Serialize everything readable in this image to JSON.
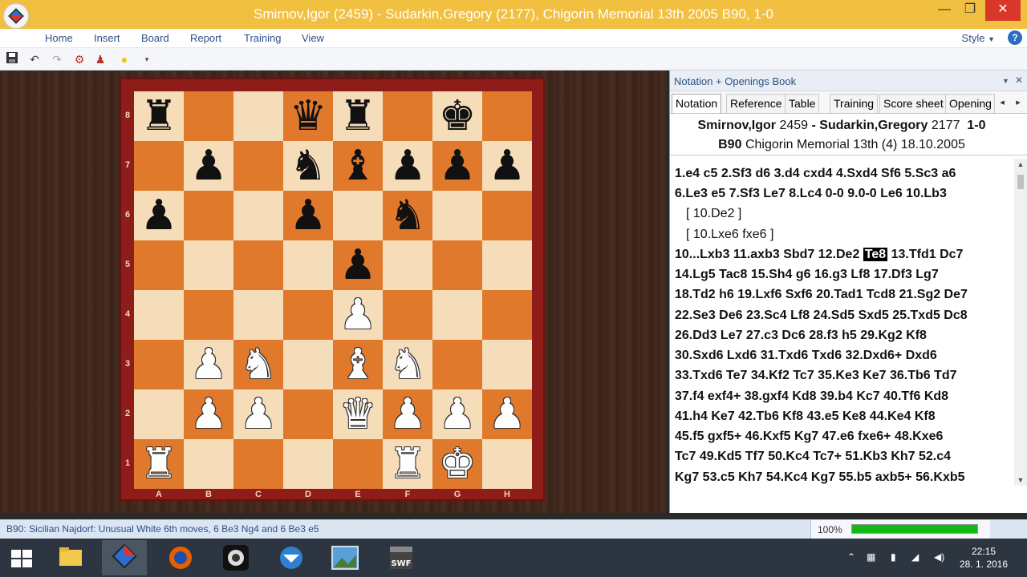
{
  "window": {
    "title": "Smirnov,Igor (2459) - Sudarkin,Gregory (2177), Chigorin Memorial 13th 2005  B90, 1-0",
    "minimize": "—",
    "maximize": "❐",
    "close": "✕"
  },
  "menu": [
    "Home",
    "Insert",
    "Board",
    "Report",
    "Training",
    "View"
  ],
  "style_label": "Style",
  "style_arrow": "▼",
  "help_label": "?",
  "toolbar_icons": [
    "save-icon",
    "undo-icon",
    "redo-icon",
    "engine-icon",
    "figure-icon",
    "bulb-icon",
    "dropdown-icon"
  ],
  "board": {
    "files": [
      "A",
      "B",
      "C",
      "D",
      "E",
      "F",
      "G",
      "H"
    ],
    "ranks": [
      "8",
      "7",
      "6",
      "5",
      "4",
      "3",
      "2",
      "1"
    ]
  },
  "panel": {
    "title": "Notation + Openings Book",
    "pin": "▼",
    "close": "✕",
    "tabs": [
      "Notation",
      "Reference",
      "Table",
      "Training",
      "Score sheet",
      "Opening"
    ],
    "tab_prev": "◂",
    "tab_next": "▸",
    "white_name": "Smirnov,Igor",
    "white_elo": "2459",
    "dash": "-",
    "black_name": "Sudarkin,Gregory",
    "black_elo": "2177",
    "result": "1-0",
    "eco": "B90",
    "event": "Chigorin Memorial 13th (4) 18.10.2005"
  },
  "moves": [
    "1.e4  c5  2.Sf3  d6  3.d4  cxd4  4.Sxd4  Sf6  5.Sc3  a6",
    "6.Le3  e5  7.Sf3  Le7  8.Lc4  0-0  9.0-0  Le6  10.Lb3",
    "[ 10.De2 ]",
    "[ 10.Lxe6  fxe6 ]",
    "14.Lg5  Tac8  15.Sh4  g6  16.g3  Lf8  17.Df3  Lg7",
    "18.Td2  h6  19.Lxf6  Sxf6  20.Tad1  Tcd8  21.Sg2  De7",
    "22.Se3  De6  23.Sc4  Lf8  24.Sd5  Sxd5  25.Txd5  Dc8",
    "26.Dd3  Le7  27.c3  Dc6  28.f3  h5  29.Kg2  Kf8",
    "30.Sxd6  Lxd6  31.Txd6  Txd6  32.Dxd6+  Dxd6",
    "33.Txd6  Te7  34.Kf2  Tc7  35.Ke3  Ke7  36.Tb6  Td7",
    "37.f4  exf4+  38.gxf4  Kd8  39.b4  Kc7  40.Tf6  Kd8",
    "41.h4  Ke7  42.Tb6  Kf8  43.e5  Ke8  44.Ke4  Kf8",
    "45.f5  gxf5+  46.Kxf5  Kg7  47.e6  fxe6+  48.Kxe6",
    "Tc7  49.Kd5  Tf7  50.Kc4  Tc7+  51.Kb3  Kh7  52.c4",
    "Kg7  53.c5  Kh7  54.Kc4  Kg7  55.b5  axb5+  56.Kxb5"
  ],
  "line10": {
    "before": "10...Lxb3  11.axb3  Sbd7  12.De2 ",
    "current": "Te8",
    "after": " 13.Tfd1  Dc7"
  },
  "status": {
    "text": "B90: Sicilian Najdorf: Unusual White 6th moves, 6 Be3 Ng4 and 6 Be3 e5",
    "zoom_label": "100%",
    "zoom_value": 1.0
  },
  "scroll_up": "▲",
  "scroll_down": "▼",
  "taskbar": {
    "apps": [
      "start-icon",
      "file-explorer-icon",
      "chessbase-icon",
      "firefox-icon",
      "camera-icon",
      "thunderbird-icon",
      "photos-icon",
      "swf-icon"
    ],
    "time": "22:15",
    "date": "28. 1. 2016"
  },
  "colors": {
    "titlebar": "#f1c040",
    "light_square": "#f6ddb9",
    "dark_square": "#e0792c",
    "board_frame": "#8e1c18",
    "zoom_fill": "#14b814"
  }
}
